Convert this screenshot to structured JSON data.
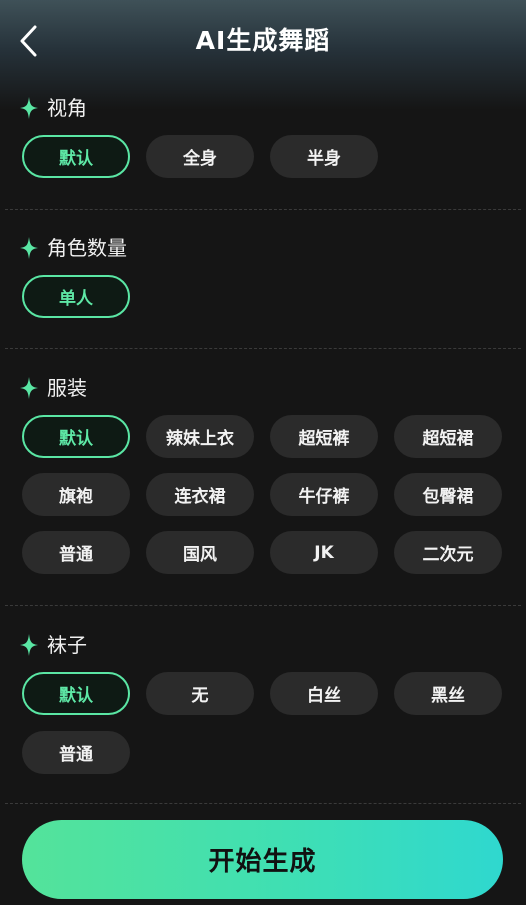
{
  "header": {
    "title": "AI生成舞蹈",
    "back_icon": "chevron-left-icon"
  },
  "colors": {
    "accent": "#5ae6a4",
    "background": "#151515",
    "chip_bg": "#2b2b2b",
    "button_gradient_start": "#54e39a",
    "button_gradient_end": "#2fd8cf"
  },
  "sections": {
    "view": {
      "title": "视角",
      "options": [
        {
          "label": "默认",
          "selected": true
        },
        {
          "label": "全身",
          "selected": false
        },
        {
          "label": "半身",
          "selected": false
        }
      ]
    },
    "count": {
      "title": "角色数量",
      "options": [
        {
          "label": "单人",
          "selected": true
        }
      ]
    },
    "outfit": {
      "title": "服装",
      "options": [
        {
          "label": "默认",
          "selected": true
        },
        {
          "label": "辣妹上衣",
          "selected": false
        },
        {
          "label": "超短裤",
          "selected": false
        },
        {
          "label": "超短裙",
          "selected": false
        },
        {
          "label": "旗袍",
          "selected": false
        },
        {
          "label": "连衣裙",
          "selected": false
        },
        {
          "label": "牛仔裤",
          "selected": false
        },
        {
          "label": "包臀裙",
          "selected": false
        },
        {
          "label": "普通",
          "selected": false
        },
        {
          "label": "国风",
          "selected": false
        },
        {
          "label": "JK",
          "selected": false
        },
        {
          "label": "二次元",
          "selected": false
        }
      ]
    },
    "socks": {
      "title": "袜子",
      "options": [
        {
          "label": "默认",
          "selected": true
        },
        {
          "label": "无",
          "selected": false
        },
        {
          "label": "白丝",
          "selected": false
        },
        {
          "label": "黑丝",
          "selected": false
        },
        {
          "label": "普通",
          "selected": false
        }
      ]
    }
  },
  "footer": {
    "generate_label": "开始生成"
  }
}
